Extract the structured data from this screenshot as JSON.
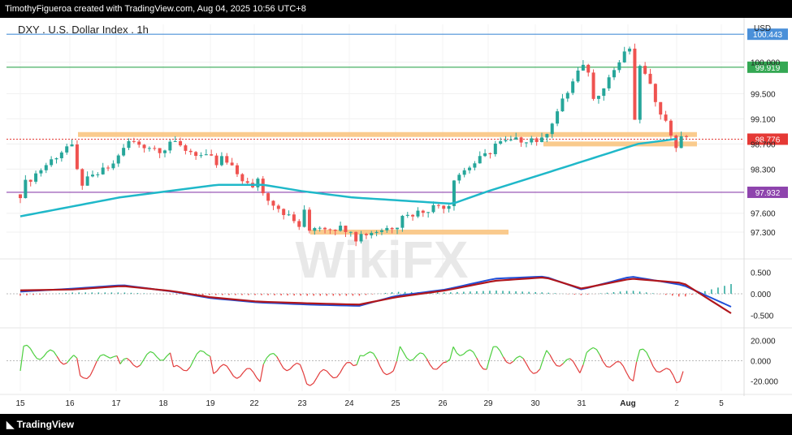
{
  "header": {
    "caption": "TimothyFigueroa created with TradingView.com, Aug 04, 2025 10:56 UTC+8"
  },
  "footer": {
    "brand": "TradingView"
  },
  "watermark": "WikiFX",
  "colors": {
    "up": "#26a69a",
    "down": "#ef5350",
    "ema": "#1fb8c9",
    "zone": "#f9c27a",
    "macd": "#1e4fd8",
    "signal": "#b0161c",
    "rsi_up": "#4ccf3e",
    "rsi_down": "#e23b3b"
  },
  "chart_data": {
    "type": "candlestick",
    "title": "DXY . U.S. Dollar Index . 1h",
    "currency": "USD",
    "x_ticks": [
      "15",
      "16",
      "17",
      "18",
      "19",
      "22",
      "23",
      "24",
      "25",
      "26",
      "29",
      "30",
      "31",
      "Aug",
      "2",
      "5"
    ],
    "price_ticks": [
      "100.000",
      "99.500",
      "99.100",
      "98.700",
      "98.300",
      "97.600",
      "97.300"
    ],
    "ylim": [
      96.9,
      100.6
    ],
    "price_path": [
      [
        "15",
        97.9
      ],
      [
        "15",
        98.05
      ],
      [
        "15",
        98.1
      ],
      [
        "16",
        98.05
      ],
      [
        "16",
        98.7
      ],
      [
        "16",
        98.6
      ],
      [
        "17",
        98.55
      ],
      [
        "17",
        98.75
      ],
      [
        "17",
        98.4
      ],
      [
        "17",
        98.6
      ],
      [
        "18",
        98.75
      ],
      [
        "18",
        98.7
      ],
      [
        "18",
        98.6
      ],
      [
        "19",
        98.5
      ],
      [
        "19",
        98.35
      ],
      [
        "19",
        98.5
      ],
      [
        "19",
        98.45
      ],
      [
        "22",
        98.2
      ],
      [
        "22",
        97.95
      ],
      [
        "22",
        97.9
      ],
      [
        "22",
        97.95
      ],
      [
        "23",
        97.75
      ],
      [
        "23",
        97.3
      ],
      [
        "23",
        97.4
      ],
      [
        "23",
        97.35
      ],
      [
        "24",
        97.35
      ],
      [
        "24",
        97.2
      ],
      [
        "24",
        97.25
      ],
      [
        "25",
        97.4
      ],
      [
        "25",
        97.45
      ],
      [
        "25",
        97.6
      ],
      [
        "25",
        97.55
      ],
      [
        "26",
        97.75
      ],
      [
        "26",
        97.65
      ],
      [
        "26",
        97.75
      ],
      [
        "26",
        98.15
      ],
      [
        "29",
        98.55
      ],
      [
        "29",
        98.6
      ],
      [
        "29",
        98.7
      ],
      [
        "30",
        98.85
      ],
      [
        "30",
        98.8
      ],
      [
        "30",
        98.7
      ],
      [
        "30",
        98.75
      ],
      [
        "31",
        99.35
      ],
      [
        "31",
        99.95
      ],
      [
        "31",
        99.85
      ],
      [
        "31",
        99.9
      ],
      [
        "Aug",
        100.05
      ],
      [
        "Aug",
        100.2
      ],
      [
        "Aug",
        100.25
      ],
      [
        "Aug",
        98.9
      ],
      [
        "2",
        98.85
      ],
      [
        "2",
        98.65
      ],
      [
        "2",
        98.75
      ]
    ],
    "ema_path": [
      [
        "15",
        97.55
      ],
      [
        "17",
        97.85
      ],
      [
        "19",
        98.05
      ],
      [
        "22",
        98.05
      ],
      [
        "23",
        97.95
      ],
      [
        "24",
        97.85
      ],
      [
        "25",
        97.8
      ],
      [
        "26",
        97.75
      ],
      [
        "29",
        97.95
      ],
      [
        "30",
        98.2
      ],
      [
        "31",
        98.45
      ],
      [
        "Aug",
        98.7
      ],
      [
        "2",
        98.78
      ]
    ],
    "levels": [
      {
        "label": "100.443",
        "value": 100.443,
        "color": "#4a90d9",
        "style": "solid"
      },
      {
        "label": "99.919",
        "value": 99.919,
        "color": "#34a853",
        "style": "solid"
      },
      {
        "label": "98.776",
        "value": 98.776,
        "color": "#e53935",
        "style": "dotted"
      },
      {
        "label": "97.932",
        "value": 97.932,
        "color": "#8e44ad",
        "style": "solid"
      }
    ],
    "zones": [
      {
        "from": "16",
        "to": "2",
        "value": 98.85
      },
      {
        "from": "30",
        "to": "2",
        "value": 98.7
      },
      {
        "from": "23",
        "to": "29",
        "value": 97.3
      }
    ],
    "macd": {
      "ticks": [
        "0.500",
        "0.000",
        "-0.500"
      ],
      "ylim": [
        -0.75,
        0.75
      ],
      "macd_path": [
        [
          "15",
          0.05
        ],
        [
          "16",
          0.12
        ],
        [
          "17",
          0.2
        ],
        [
          "18",
          0.05
        ],
        [
          "19",
          -0.1
        ],
        [
          "22",
          -0.2
        ],
        [
          "23",
          -0.25
        ],
        [
          "24",
          -0.28
        ],
        [
          "25",
          -0.05
        ],
        [
          "26",
          0.1
        ],
        [
          "29",
          0.35
        ],
        [
          "30",
          0.4
        ],
        [
          "31",
          0.1
        ],
        [
          "Aug",
          0.4
        ],
        [
          "2",
          0.2
        ],
        [
          "5",
          -0.3
        ]
      ],
      "signal_path": [
        [
          "15",
          0.08
        ],
        [
          "16",
          0.1
        ],
        [
          "17",
          0.18
        ],
        [
          "18",
          0.06
        ],
        [
          "19",
          -0.08
        ],
        [
          "22",
          -0.18
        ],
        [
          "23",
          -0.22
        ],
        [
          "24",
          -0.25
        ],
        [
          "25",
          -0.08
        ],
        [
          "26",
          0.08
        ],
        [
          "29",
          0.3
        ],
        [
          "30",
          0.38
        ],
        [
          "31",
          0.12
        ],
        [
          "Aug",
          0.35
        ],
        [
          "2",
          0.25
        ],
        [
          "5",
          -0.45
        ]
      ]
    },
    "rsi": {
      "ticks": [
        "20.000",
        "0.000",
        "-20.000"
      ],
      "ylim": [
        -30,
        30
      ],
      "path": [
        [
          "15",
          -10
        ],
        [
          "15",
          10
        ],
        [
          "16",
          0
        ],
        [
          "16",
          -18
        ],
        [
          "17",
          12
        ],
        [
          "17",
          -5
        ],
        [
          "18",
          8
        ],
        [
          "18",
          -12
        ],
        [
          "19",
          10
        ],
        [
          "19",
          -8
        ],
        [
          "22",
          -15
        ],
        [
          "22",
          5
        ],
        [
          "23",
          -10
        ],
        [
          "23",
          -20
        ],
        [
          "24",
          -5
        ],
        [
          "24",
          12
        ],
        [
          "25",
          -15
        ],
        [
          "25",
          10
        ],
        [
          "26",
          -8
        ],
        [
          "26",
          15
        ],
        [
          "29",
          -5
        ],
        [
          "29",
          10
        ],
        [
          "30",
          -10
        ],
        [
          "30",
          5
        ],
        [
          "31",
          -8
        ],
        [
          "31",
          12
        ],
        [
          "Aug",
          -15
        ],
        [
          "Aug",
          10
        ],
        [
          "2",
          -20
        ],
        [
          "2",
          -15
        ],
        [
          "2",
          -5
        ]
      ]
    }
  }
}
